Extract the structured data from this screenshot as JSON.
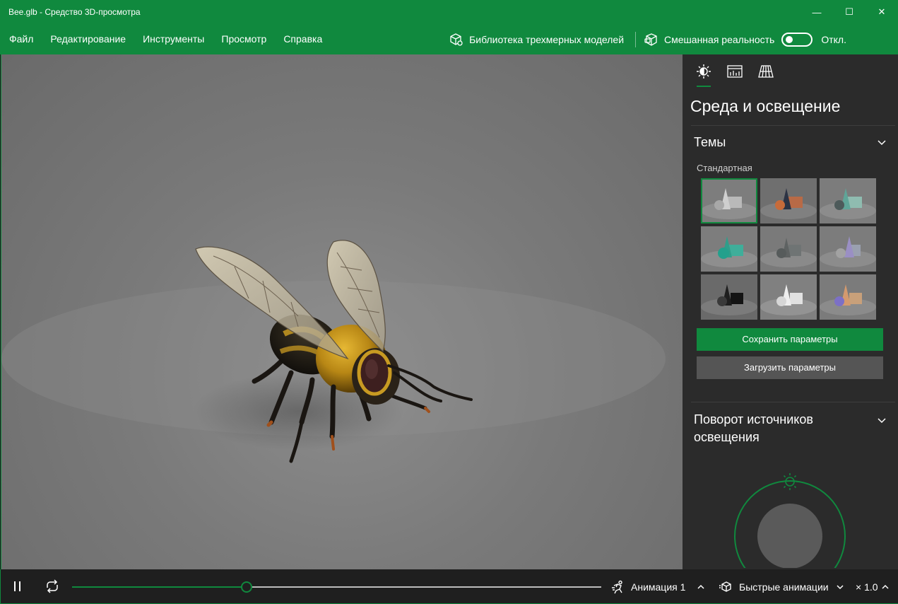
{
  "window": {
    "title": "Bee.glb - Средство 3D-просмотра",
    "minimize_glyph": "—",
    "maximize_glyph": "☐",
    "close_glyph": "✕"
  },
  "menu": {
    "items": [
      "Файл",
      "Редактирование",
      "Инструменты",
      "Просмотр",
      "Справка"
    ],
    "library_label": "Библиотека трехмерных моделей",
    "mixed_reality_label": "Смешанная реальность",
    "toggle_state": "Откл."
  },
  "panel": {
    "tabs": [
      {
        "icon": "sun-environment-icon",
        "active": true
      },
      {
        "icon": "stats-chart-icon",
        "active": false
      },
      {
        "icon": "mesh-grid-icon",
        "active": false
      }
    ],
    "title": "Среда и освещение",
    "themes": {
      "header": "Темы",
      "subheader": "Стандартная",
      "save_button": "Сохранить параметры",
      "load_button": "Загрузить параметры"
    },
    "light_rotation": {
      "header": "Поворот источников освещения"
    }
  },
  "bottom": {
    "animation_progress": 0.33,
    "animation_name": "Анимация 1",
    "quick_animations": "Быстрые анимации",
    "speed": "× 1.0"
  },
  "colors": {
    "accent": "#10893e",
    "panel_bg": "#2b2b2b",
    "bottom_bg": "#1f1f1f"
  }
}
